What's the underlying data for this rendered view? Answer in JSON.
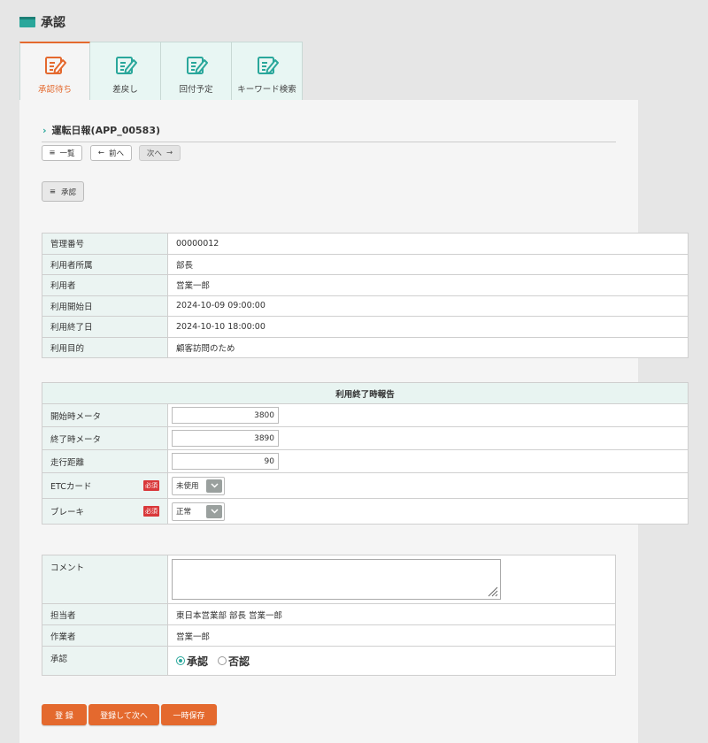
{
  "header": {
    "title": "承認"
  },
  "tabs": [
    {
      "label": "承認待ち",
      "active": true
    },
    {
      "label": "差戻し"
    },
    {
      "label": "回付予定"
    },
    {
      "label": "キーワード検索"
    }
  ],
  "record": {
    "title": "運転日報(APP_00583)"
  },
  "nav": {
    "list": "一覧",
    "prev": "前へ",
    "next": "次へ"
  },
  "approve_button": "承認",
  "info": [
    {
      "label": "管理番号",
      "value": "00000012"
    },
    {
      "label": "利用者所属",
      "value": "部長"
    },
    {
      "label": "利用者",
      "value": "営業一郎"
    },
    {
      "label": "利用開始日",
      "value": "2024-10-09 09:00:00"
    },
    {
      "label": "利用終了日",
      "value": "2024-10-10 18:00:00"
    },
    {
      "label": "利用目的",
      "value": "顧客訪問のため"
    }
  ],
  "report": {
    "title": "利用終了時報告",
    "start_meter": {
      "label": "開始時メータ",
      "value": "3800"
    },
    "end_meter": {
      "label": "終了時メータ",
      "value": "3890"
    },
    "distance": {
      "label": "走行距離",
      "value": "90"
    },
    "etc": {
      "label": "ETCカード",
      "required": "必須",
      "value": "未使用"
    },
    "brake": {
      "label": "ブレーキ",
      "required": "必須",
      "value": "正常"
    }
  },
  "approval": {
    "comment_label": "コメント",
    "comment_value": "",
    "person_label": "担当者",
    "person_value": "東日本営業部 部長 営業一郎",
    "worker_label": "作業者",
    "worker_value": "営業一郎",
    "decision_label": "承認",
    "options": [
      "承認",
      "否認"
    ],
    "selected": "承認"
  },
  "actions": {
    "register": "登 録",
    "register_next": "登録して次へ",
    "temp_save": "一時保存"
  },
  "colors": {
    "accent": "#e4692e",
    "teal": "#2aa79b",
    "required": "#d9383a"
  }
}
